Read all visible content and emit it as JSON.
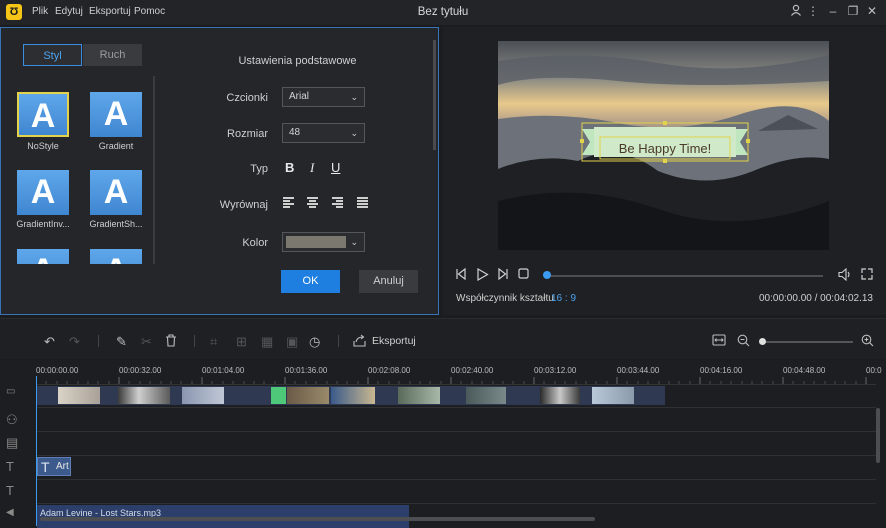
{
  "titlebar": {
    "app_logo": "Ʊ",
    "menu": [
      "Plik",
      "Edytuj",
      "Eksportuj",
      "Pomoc"
    ],
    "title": "Bez tytułu",
    "icons": [
      "user-icon",
      "more-icon",
      "minimize-icon",
      "restore-icon",
      "close-icon"
    ]
  },
  "style_panel": {
    "tabs": [
      "Styl",
      "Ruch"
    ],
    "active_tab": "Styl",
    "tiles": [
      {
        "glyph": "A",
        "label": "NoStyle",
        "selected": true
      },
      {
        "glyph": "A",
        "label": "Gradient",
        "selected": false
      },
      {
        "glyph": "A",
        "label": "GradientInv...",
        "selected": false
      },
      {
        "glyph": "A",
        "label": "GradientSh...",
        "selected": false
      },
      {
        "glyph": "A",
        "label": "",
        "selected": false
      },
      {
        "glyph": "A",
        "label": "",
        "selected": false
      }
    ]
  },
  "settings": {
    "title": "Ustawienia podstawowe",
    "font_label": "Czcionki",
    "font_value": "Arial",
    "size_label": "Rozmiar",
    "size_value": "48",
    "type_label": "Typ",
    "bold": "B",
    "italic": "I",
    "underline": "U",
    "align_label": "Wyrównaj",
    "color_label": "Kolor",
    "color_value": "#7b7870",
    "ok": "OK",
    "cancel": "Anuluj"
  },
  "preview": {
    "caption_text": "Be Happy Time!",
    "aspect_label": "Współczynnik kształtu",
    "aspect_value": "16 : 9",
    "time": "00:00:00.00 / 00:04:02.13",
    "progress": 0.0
  },
  "toolbar": {
    "export_label": "Eksportuj",
    "icons": [
      "undo-icon",
      "redo-icon",
      "edit-icon",
      "cut-icon",
      "delete-icon",
      "crop-icon",
      "zoom-icon",
      "mosaic-icon",
      "freeze-icon",
      "speed-icon",
      "export-icon",
      "fit-icon",
      "zoom-out-icon",
      "zoom-in-icon"
    ]
  },
  "timeline": {
    "ticks": [
      "00:00:00.00",
      "00:00:32.00",
      "00:01:04.00",
      "00:01:36.00",
      "00:02:08.00",
      "00:02:40.00",
      "00:03:12.00",
      "00:03:44.00",
      "00:04:16.00",
      "00:04:48.00",
      "00:0"
    ],
    "text_clip_label": "Art",
    "audio_clip_label": "Adam Levine - Lost Stars.mp3"
  },
  "colors": {
    "accent": "#1f7fe0",
    "tile_blue": "#4b95e0",
    "selection_yellow": "#e3d24b"
  }
}
